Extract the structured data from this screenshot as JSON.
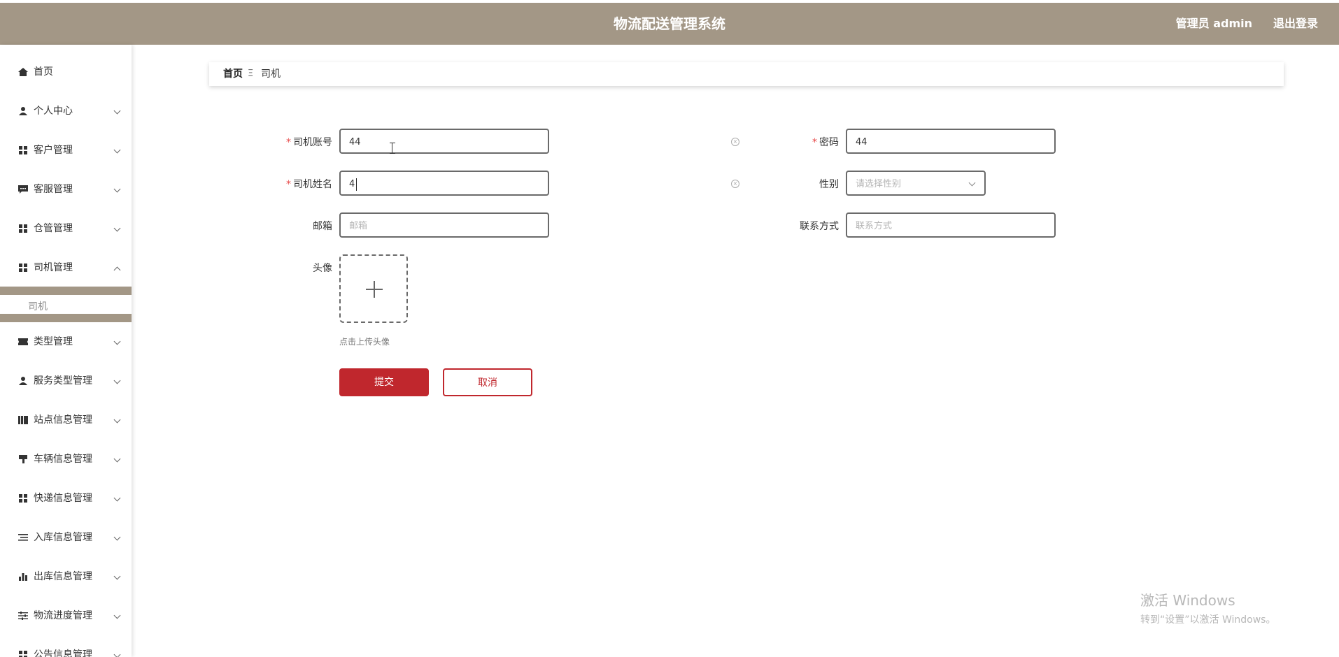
{
  "header": {
    "title": "物流配送管理系统",
    "user": "管理员 admin",
    "logout": "退出登录"
  },
  "sidebar": {
    "items": [
      {
        "label": "首页",
        "icon": "home-icon",
        "arrow": "none"
      },
      {
        "label": "个人中心",
        "icon": "person-icon",
        "arrow": "down"
      },
      {
        "label": "客户管理",
        "icon": "grid-icon",
        "arrow": "down"
      },
      {
        "label": "客服管理",
        "icon": "chat-icon",
        "arrow": "down"
      },
      {
        "label": "仓管管理",
        "icon": "grid-icon",
        "arrow": "down"
      },
      {
        "label": "司机管理",
        "icon": "grid-icon",
        "arrow": "up"
      },
      {
        "label": "类型管理",
        "icon": "ticket-icon",
        "arrow": "down"
      },
      {
        "label": "服务类型管理",
        "icon": "person-icon",
        "arrow": "down"
      },
      {
        "label": "站点信息管理",
        "icon": "library-icon",
        "arrow": "down"
      },
      {
        "label": "车辆信息管理",
        "icon": "brush-icon",
        "arrow": "down"
      },
      {
        "label": "快递信息管理",
        "icon": "grid-icon",
        "arrow": "down"
      },
      {
        "label": "入库信息管理",
        "icon": "list-icon",
        "arrow": "down"
      },
      {
        "label": "出库信息管理",
        "icon": "bar-chart-icon",
        "arrow": "down"
      },
      {
        "label": "物流进度管理",
        "icon": "sliders-icon",
        "arrow": "down"
      },
      {
        "label": "公告信息管理",
        "icon": "grid-icon",
        "arrow": "down"
      }
    ],
    "sub_item": "司机"
  },
  "breadcrumb": {
    "home": "首页",
    "separator": "Ξ",
    "current": "司机"
  },
  "form": {
    "account_label": "司机账号",
    "account_value": "44",
    "password_label": "密码",
    "password_value": "44",
    "name_label": "司机姓名",
    "name_value": "4",
    "gender_label": "性别",
    "gender_placeholder": "请选择性别",
    "email_label": "邮箱",
    "email_placeholder": "邮箱",
    "phone_label": "联系方式",
    "phone_placeholder": "联系方式",
    "avatar_label": "头像",
    "avatar_hint": "点击上传头像",
    "submit": "提交",
    "cancel": "取消",
    "required_mark": "*"
  },
  "watermark": {
    "line1": "激活 Windows",
    "line2": "转到“设置”以激活 Windows。"
  },
  "colors": {
    "header_bg": "#a39786",
    "primary": "#c0272d"
  }
}
